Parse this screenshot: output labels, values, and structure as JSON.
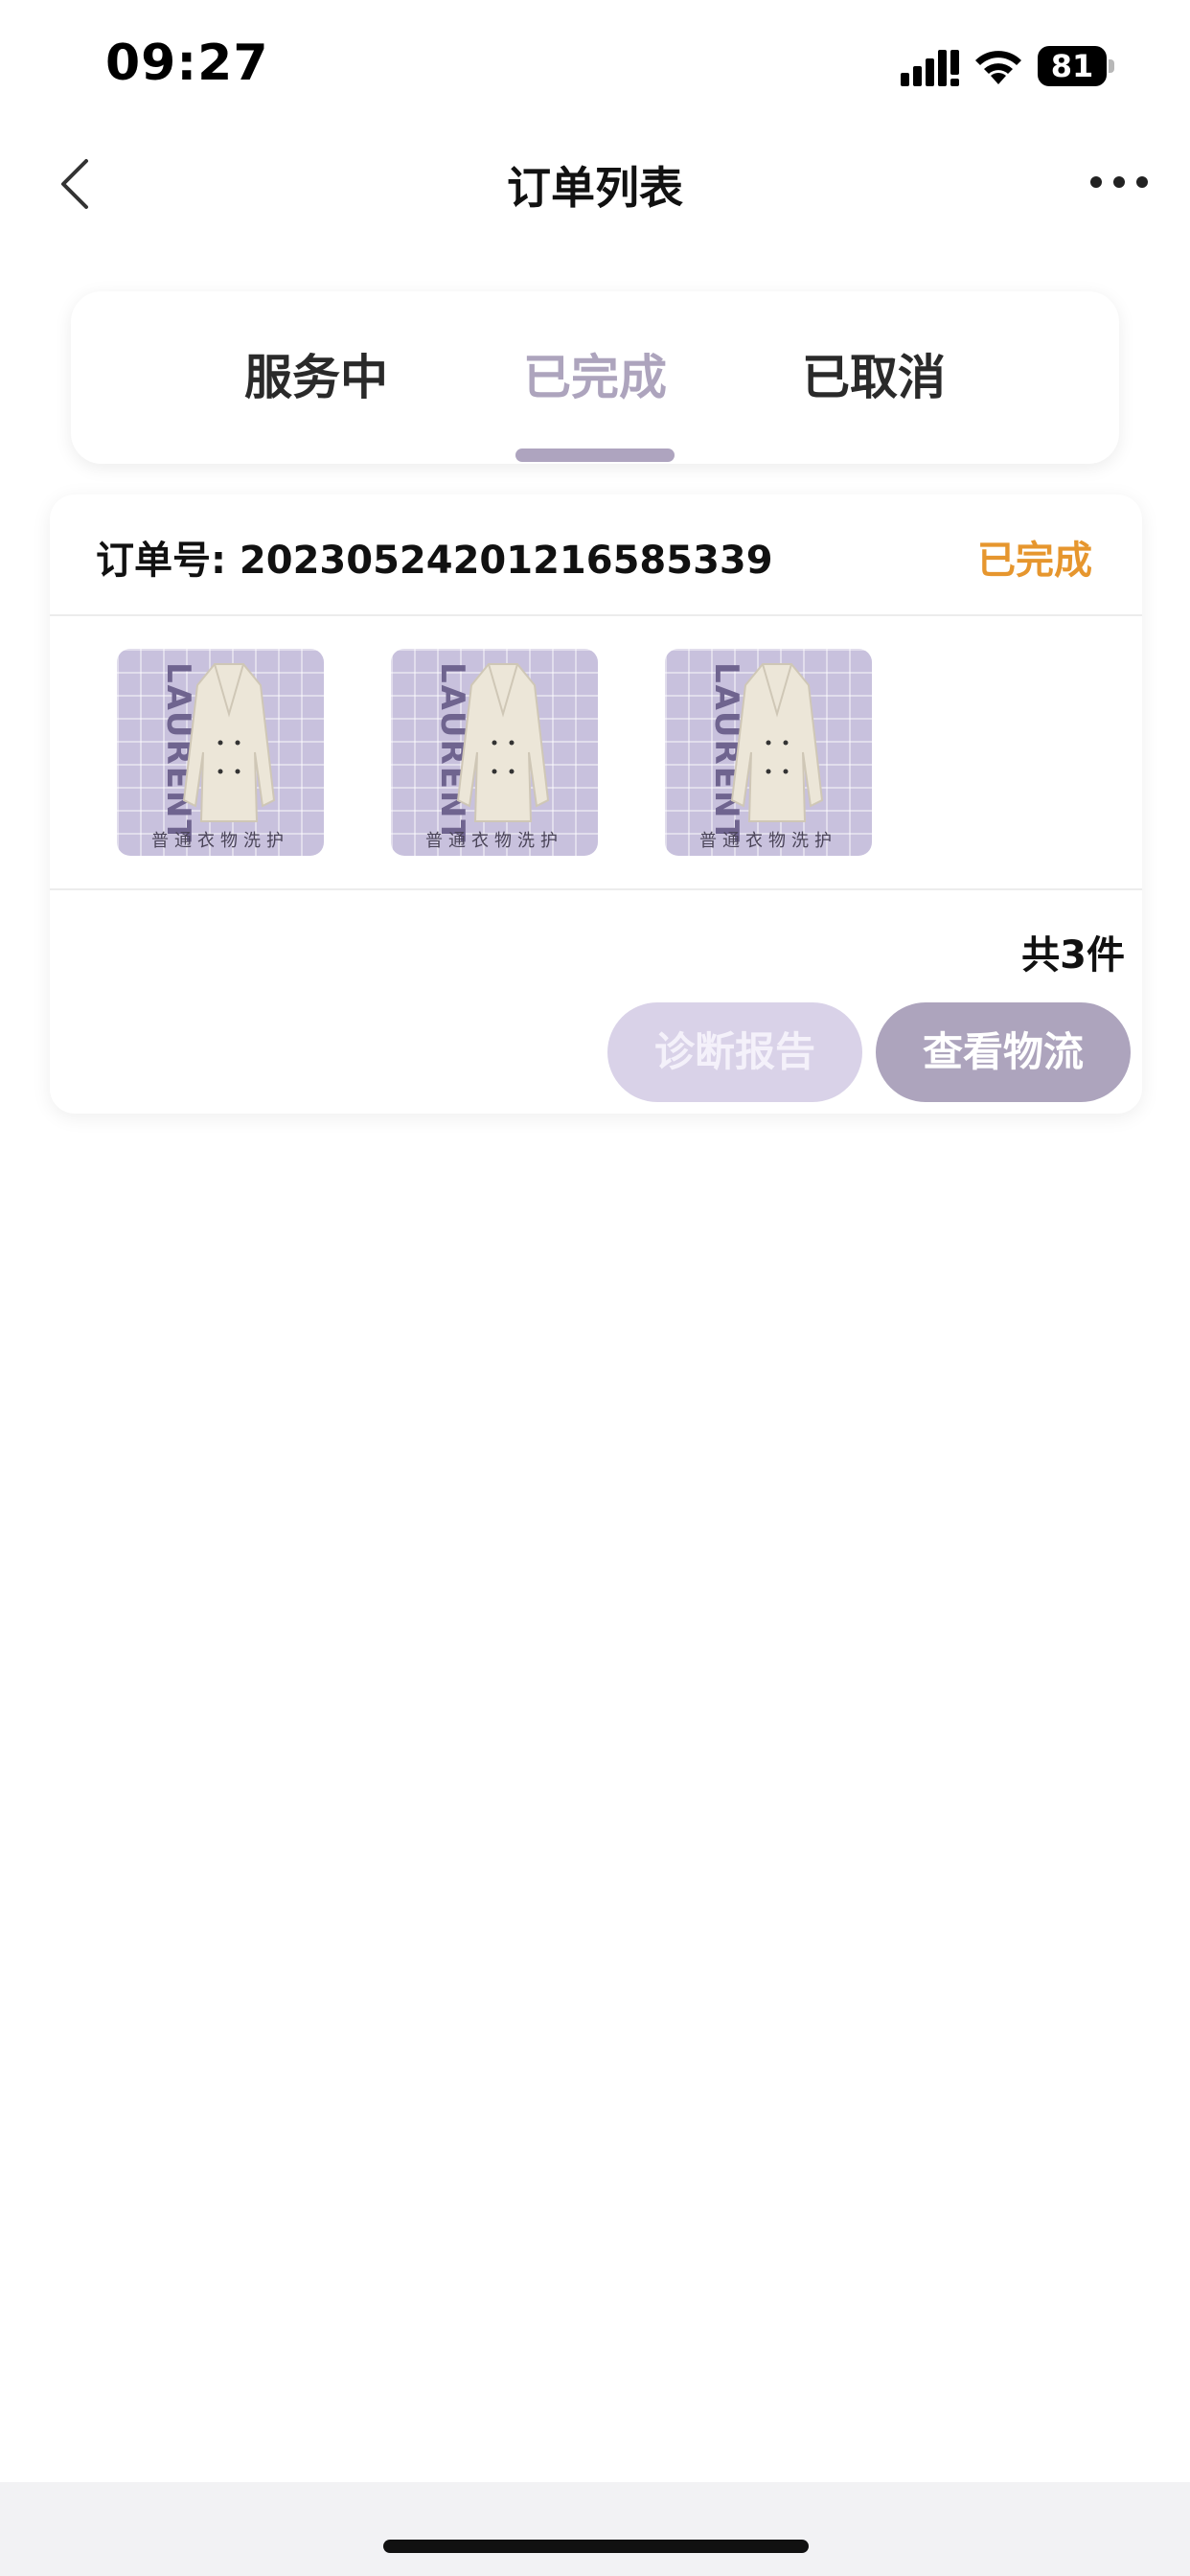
{
  "status_bar": {
    "time": "09:27",
    "battery": "81"
  },
  "nav": {
    "title": "订单列表"
  },
  "tabs": [
    {
      "label": "服务中",
      "active": false
    },
    {
      "label": "已完成",
      "active": true
    },
    {
      "label": "已取消",
      "active": false
    }
  ],
  "order": {
    "number_text": "订单号: 20230524201216585339",
    "status": "已完成",
    "products": [
      {
        "brand": "LAURENT",
        "caption": "普通衣物洗护"
      },
      {
        "brand": "LAURENT",
        "caption": "普通衣物洗护"
      },
      {
        "brand": "LAURENT",
        "caption": "普通衣物洗护"
      }
    ],
    "item_count": "共3件",
    "buttons": {
      "report": "诊断报告",
      "logistics": "查看物流"
    }
  },
  "colors": {
    "accent": "#ada4bd",
    "status_orange": "#e6962e"
  }
}
